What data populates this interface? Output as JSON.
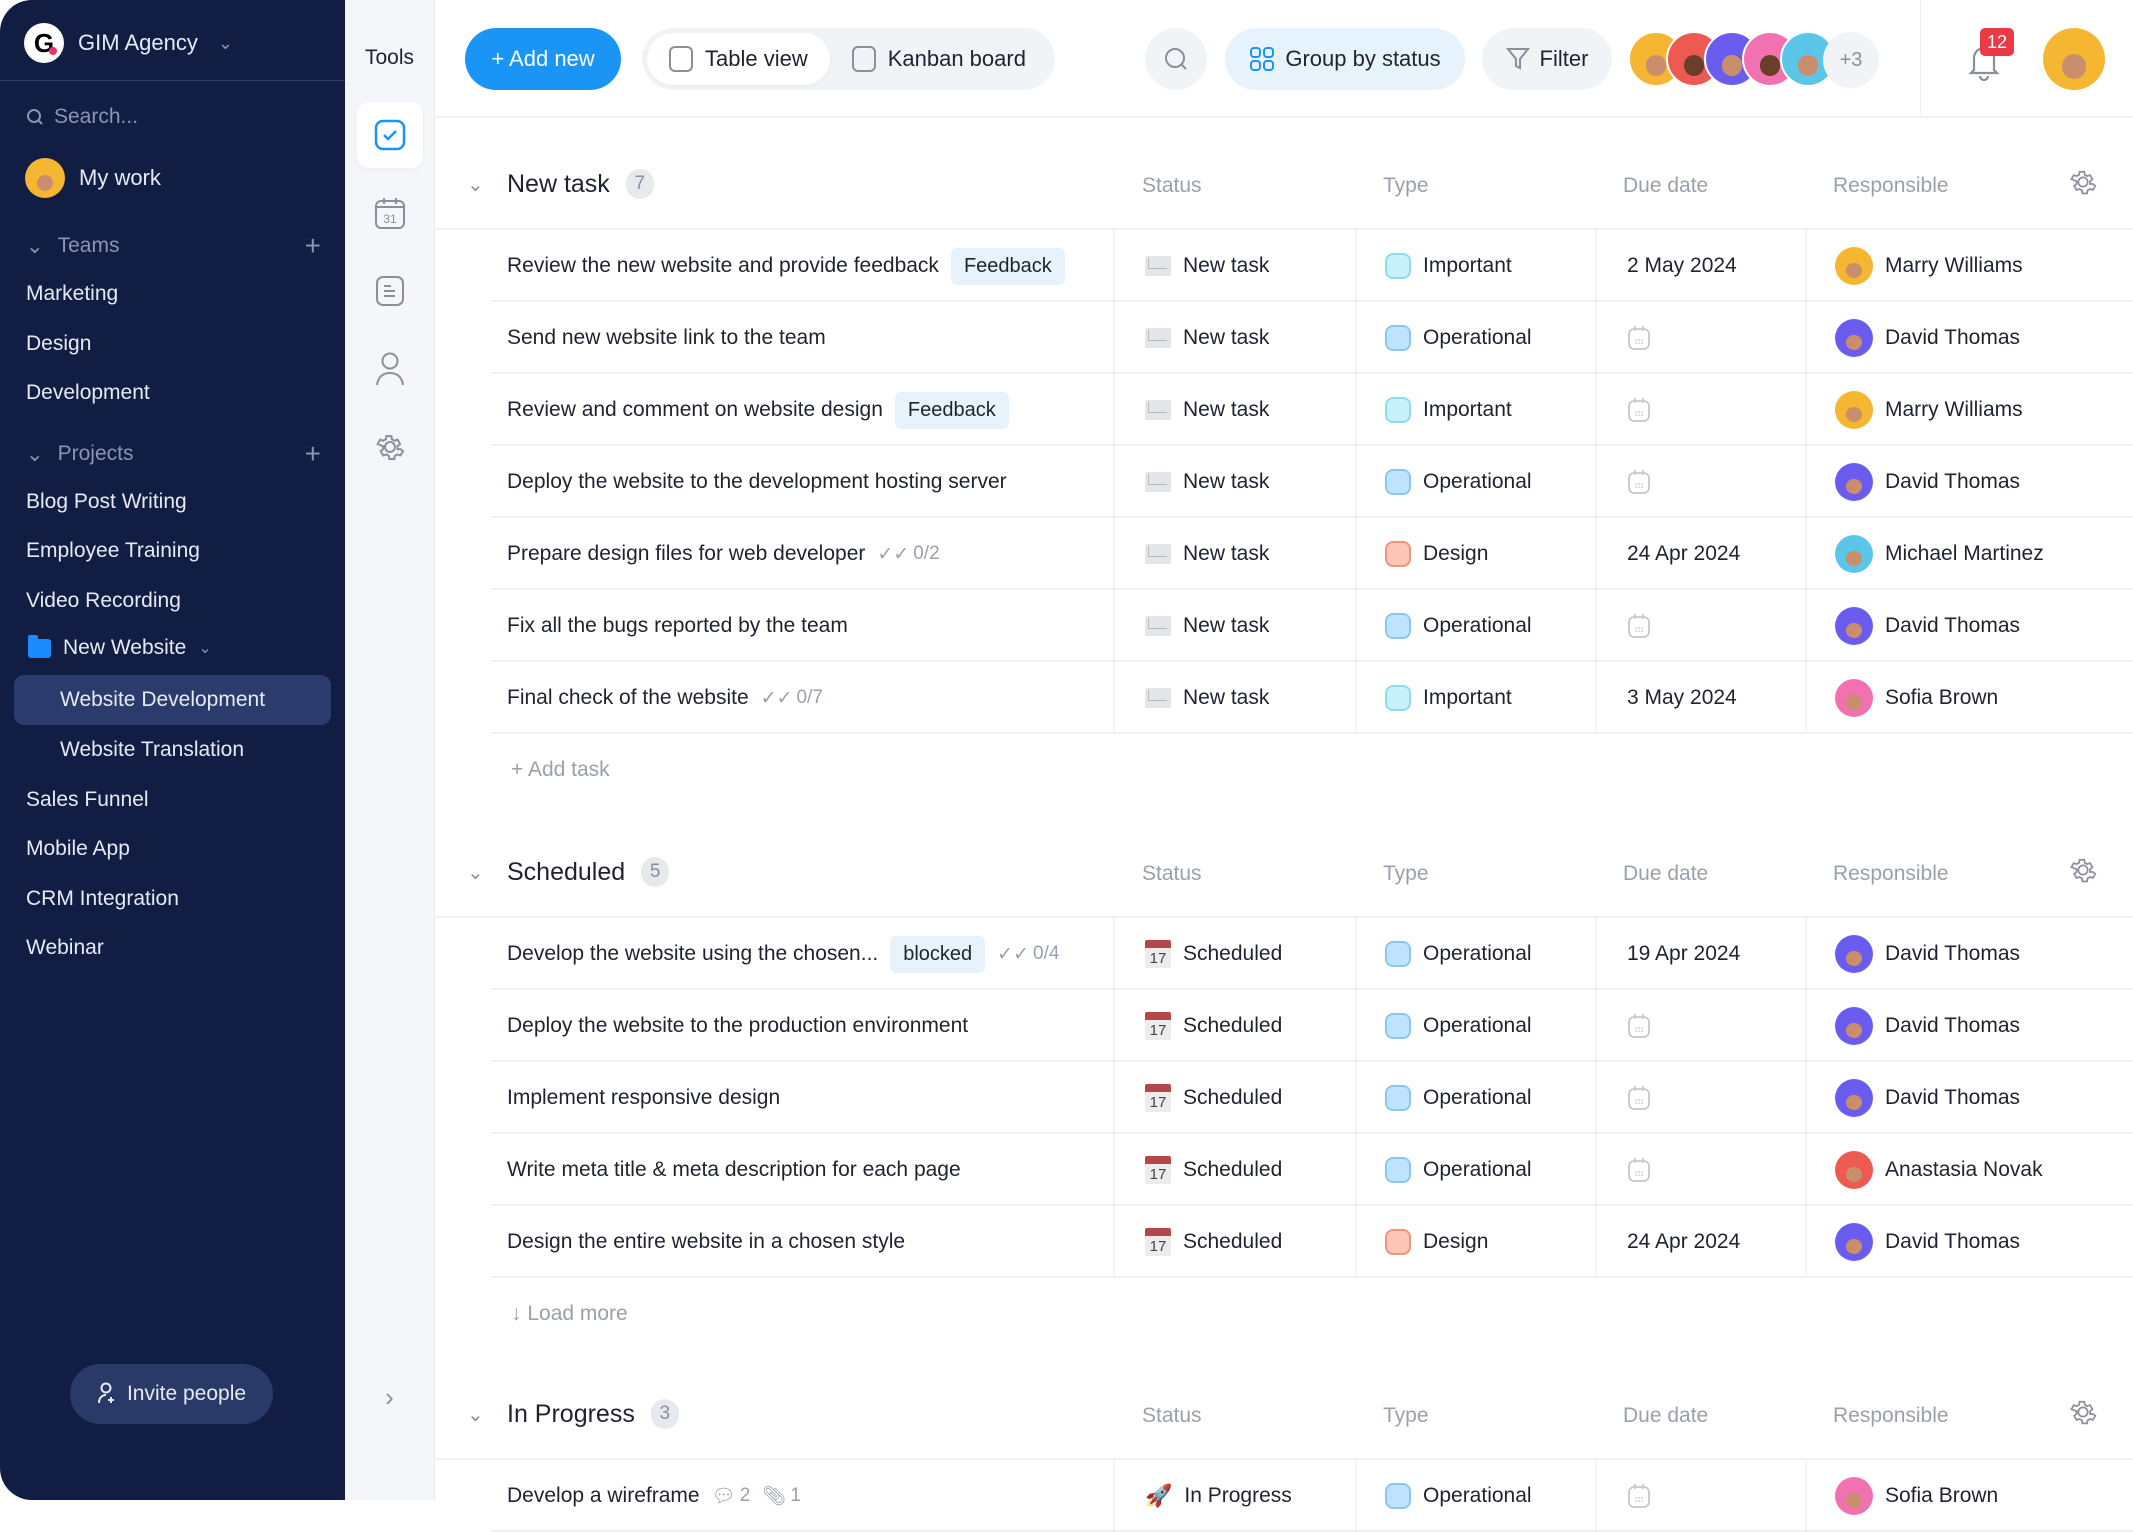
{
  "sidebar": {
    "workspace": "GIM Agency",
    "logo_letter": "G",
    "search_placeholder": "Search...",
    "my_work": "My work",
    "teams_label": "Teams",
    "teams": [
      "Marketing",
      "Design",
      "Development"
    ],
    "projects_label": "Projects",
    "projects": [
      "Blog Post Writing",
      "Employee Training",
      "Video Recording"
    ],
    "folder": {
      "label": "New Website",
      "children": [
        "Website Development",
        "Website Translation"
      ],
      "active_child": "Website Development"
    },
    "projects_after": [
      "Sales Funnel",
      "Mobile App",
      "CRM Integration",
      "Webinar"
    ],
    "invite": "Invite people"
  },
  "tools": {
    "title": "Tools",
    "items": [
      "tasks-icon",
      "calendar-icon",
      "notes-icon",
      "user-icon",
      "gear-icon"
    ],
    "calendar_day": "31"
  },
  "toolbar": {
    "add_new": "+ Add new",
    "views": [
      "Table view",
      "Kanban board"
    ],
    "active_view": "Table view",
    "group_by": "Group by status",
    "filter": "Filter",
    "more_members": "+3",
    "notifications": "12"
  },
  "columns": {
    "status": "Status",
    "type": "Type",
    "due": "Due date",
    "responsible": "Responsible"
  },
  "colors": {
    "accent": "#1a95f5",
    "sidebar": "#111d42",
    "important": "#c9f1fb",
    "operational": "#bfe2fd",
    "design": "#fdc7b8",
    "badge": "#ea3a45"
  },
  "people": {
    "Marry Williams": "#f5b731",
    "David Thomas": "#6b5cf0",
    "Michael Martinez": "#5cc6e8",
    "Sofia Brown": "#f272b1",
    "Anastasia Novak": "#ee5a52"
  },
  "groups": [
    {
      "title": "New task",
      "count": "7",
      "rows": [
        {
          "title": "Review the new website and provide feedback",
          "tag": "Feedback",
          "status": "New task",
          "type": "Important",
          "due": "2 May 2024",
          "responsible": "Marry Williams"
        },
        {
          "title": "Send new website link to the team",
          "status": "New task",
          "type": "Operational",
          "due": "",
          "responsible": "David Thomas"
        },
        {
          "title": "Review and comment on website design",
          "tag": "Feedback",
          "status": "New task",
          "type": "Important",
          "due": "",
          "responsible": "Marry Williams"
        },
        {
          "title": "Deploy the website to the development hosting server",
          "status": "New task",
          "type": "Operational",
          "due": "",
          "responsible": "David Thomas"
        },
        {
          "title": "Prepare design files for web developer",
          "checklist": "0/2",
          "status": "New task",
          "type": "Design",
          "due": "24 Apr 2024",
          "responsible": "Michael Martinez"
        },
        {
          "title": "Fix all the bugs reported by the team",
          "status": "New task",
          "type": "Operational",
          "due": "",
          "responsible": "David Thomas"
        },
        {
          "title": "Final check of the website",
          "checklist": "0/7",
          "status": "New task",
          "type": "Important",
          "due": "3 May 2024",
          "responsible": "Sofia Brown"
        }
      ],
      "footer": "+ Add task"
    },
    {
      "title": "Scheduled",
      "count": "5",
      "rows": [
        {
          "title": "Develop the website using the chosen...",
          "tag": "blocked",
          "checklist": "0/4",
          "status": "Scheduled",
          "type": "Operational",
          "due": "19 Apr 2024",
          "responsible": "David Thomas"
        },
        {
          "title": "Deploy the website to the production environment",
          "status": "Scheduled",
          "type": "Operational",
          "due": "",
          "responsible": "David Thomas"
        },
        {
          "title": "Implement responsive design",
          "status": "Scheduled",
          "type": "Operational",
          "due": "",
          "responsible": "David Thomas"
        },
        {
          "title": "Write meta title & meta description for each page",
          "status": "Scheduled",
          "type": "Operational",
          "due": "",
          "responsible": "Anastasia Novak"
        },
        {
          "title": "Design the entire website in a chosen style",
          "status": "Scheduled",
          "type": "Design",
          "due": "24 Apr 2024",
          "responsible": "David Thomas"
        }
      ],
      "footer": "↓ Load more"
    },
    {
      "title": "In Progress",
      "count": "3",
      "rows": [
        {
          "title": "Develop a wireframe",
          "comments": "2",
          "attachments": "1",
          "status": "In Progress",
          "type": "Operational",
          "due": "",
          "responsible": "Sofia Brown"
        }
      ]
    }
  ]
}
